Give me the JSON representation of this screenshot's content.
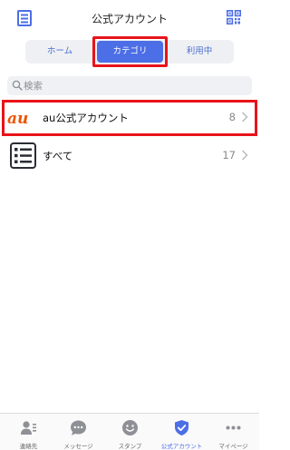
{
  "header": {
    "title": "公式アカウント",
    "left_icon": "book-icon",
    "right_icon": "qr-code-icon"
  },
  "segments": [
    {
      "label": "ホーム"
    },
    {
      "label": "カテゴリ",
      "selected": true
    },
    {
      "label": "利用中"
    }
  ],
  "search": {
    "placeholder": "検索"
  },
  "rows": [
    {
      "label": "au公式アカウント",
      "count": "8",
      "icon": "au-logo"
    },
    {
      "label": "すべて",
      "count": "17",
      "icon": "list-icon"
    }
  ],
  "tabbar": [
    {
      "label": "連絡先",
      "icon": "contacts-icon"
    },
    {
      "label": "メッセージ",
      "icon": "message-icon"
    },
    {
      "label": "スタンプ",
      "icon": "smiley-icon"
    },
    {
      "label": "公式アカウント",
      "icon": "verified-shield-icon",
      "active": true
    },
    {
      "label": "マイページ",
      "icon": "more-icon"
    }
  ],
  "colors": {
    "accent": "#4c6ee6",
    "highlight": "#e8131a",
    "au_orange": "#eb5505"
  }
}
